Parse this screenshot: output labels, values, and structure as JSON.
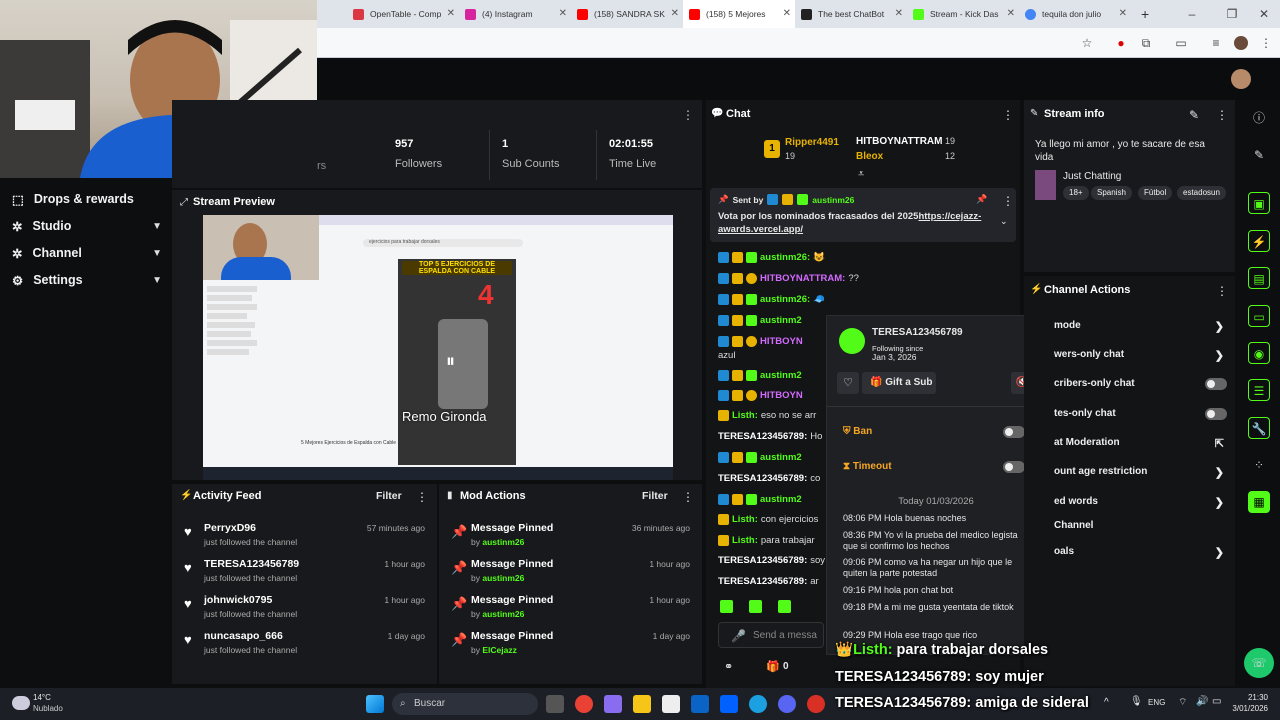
{
  "browser": {
    "tabs": [
      {
        "title": "OpenTable - Comp",
        "color": "#da3743"
      },
      {
        "title": "(4) Instagram",
        "color": "#d6249f"
      },
      {
        "title": "(158) SANDRA SK",
        "color": "#ff0000"
      },
      {
        "title": "(158) 5 Mejores",
        "color": "#ff0000"
      },
      {
        "title": "The best ChatBot",
        "color": "#222222"
      },
      {
        "title": "Stream - Kick Das",
        "color": "#53fc18"
      },
      {
        "title": "tequila don julio",
        "color": "#4285f4"
      }
    ],
    "new_tab": "+"
  },
  "sidebar": {
    "items": [
      {
        "label": "Drops & rewards",
        "icon": "gift-icon"
      },
      {
        "label": "Studio",
        "icon": "gear-icon"
      },
      {
        "label": "Channel",
        "icon": "gear-icon"
      },
      {
        "label": "Settings",
        "icon": "gear-icon"
      }
    ]
  },
  "stats": {
    "partial_label": "rs",
    "followers": {
      "value": "957",
      "label": "Followers"
    },
    "subs": {
      "value": "1",
      "label": "Sub Counts"
    },
    "time": {
      "value": "02:01:55",
      "label": "Time Live"
    }
  },
  "preview": {
    "title": "Stream Preview",
    "video_title": "TOP 5 EJERCICIOS DE ESPALDA CON CABLE",
    "number": "4",
    "exercise": "Remo Gironda",
    "yt_caption": "5 Mejores Ejercicios de Espalda con Cable ...",
    "search": "ejercicios para trabajar dorsales"
  },
  "activity": {
    "title": "Activity Feed",
    "filter": "Filter",
    "rows": [
      {
        "name": "PerryxD96",
        "sub": "just followed the channel",
        "time": "57 minutes ago"
      },
      {
        "name": "TERESA123456789",
        "sub": "just followed the channel",
        "time": "1 hour ago"
      },
      {
        "name": "johnwick0795",
        "sub": "just followed the channel",
        "time": "1 hour ago"
      },
      {
        "name": "nuncasapo_666",
        "sub": "just followed the channel",
        "time": "1 day ago"
      }
    ]
  },
  "modactions": {
    "title": "Mod Actions",
    "filter": "Filter",
    "rows": [
      {
        "action": "Message Pinned",
        "by": "by ",
        "who": "austinm26",
        "time": "36 minutes ago"
      },
      {
        "action": "Message Pinned",
        "by": "by ",
        "who": "austinm26",
        "time": "1 hour ago"
      },
      {
        "action": "Message Pinned",
        "by": "by ",
        "who": "austinm26",
        "time": "1 hour ago"
      },
      {
        "action": "Message Pinned",
        "by": "by ",
        "who": "ElCejazz",
        "time": "1 day ago"
      }
    ]
  },
  "chat": {
    "title": "Chat",
    "top": [
      {
        "name": "Ripper4491",
        "n": "19",
        "color": "#e8b300"
      },
      {
        "name": "HITBOYNATTRAM",
        "n": "19",
        "color": "#ffffff"
      },
      {
        "name": "Bleox",
        "n": "12",
        "color": "#e8b300"
      }
    ],
    "rank": "1",
    "pinned": {
      "sent_by": "Sent by",
      "who": "austinm26",
      "text": "Vota por los nominados fracasados del 2025",
      "link": "https://cejazz-awards.vercel.app/"
    },
    "messages": [
      {
        "name": "austinm26:",
        "text": "😺",
        "color": "#53fc18"
      },
      {
        "name": "HITBOYNATTRAM:",
        "text": "??",
        "color": "#d36aff"
      },
      {
        "name": "austinm26:",
        "text": "🧢",
        "color": "#53fc18"
      },
      {
        "name": "austinm2",
        "text": "",
        "color": "#53fc18"
      },
      {
        "name": "HITBOYN",
        "text": "",
        "color": "#d36aff"
      },
      {
        "name": "",
        "text": "azul",
        "color": "#dddddd"
      },
      {
        "name": "austinm2",
        "text": "",
        "color": "#53fc18"
      },
      {
        "name": "HITBOYN",
        "text": "",
        "color": "#d36aff"
      },
      {
        "name": "Listh:",
        "text": "eso no se arr",
        "color": "#53fc18"
      },
      {
        "name": "TERESA123456789:",
        "text": "Ho",
        "color": "#ffffff"
      },
      {
        "name": "austinm2",
        "text": "",
        "color": "#53fc18"
      },
      {
        "name": "TERESA123456789:",
        "text": "co",
        "color": "#ffffff"
      },
      {
        "name": "austinm2",
        "text": "",
        "color": "#53fc18"
      },
      {
        "name": "Listh:",
        "text": "con ejercicios",
        "color": "#53fc18"
      },
      {
        "name": "Listh:",
        "text": "para trabajar",
        "color": "#53fc18"
      },
      {
        "name": "TERESA123456789:",
        "text": "soy",
        "color": "#ffffff"
      },
      {
        "name": "TERESA123456789:",
        "text": "ar",
        "color": "#ffffff"
      }
    ],
    "input_placeholder": "Send a messa",
    "count": "0"
  },
  "usercard": {
    "name": "TERESA123456789",
    "following_label": "Following since",
    "following_date": "Jan 3, 2026",
    "gift": "Gift a Sub",
    "ban": "Ban",
    "timeout": "Timeout",
    "date_header": "Today 01/03/2026",
    "history": [
      {
        "time": "08:06 PM",
        "text": "Hola buenas noches"
      },
      {
        "time": "08:36 PM",
        "text": "Yo vi la prueba del medico legista que si confirmo los hechos"
      },
      {
        "time": "09:06 PM",
        "text": "como va ha negar un hijo que le quiten la parte potestad"
      },
      {
        "time": "09:16 PM",
        "text": "hola pon chat bot"
      },
      {
        "time": "09:18 PM",
        "text": "a mi me gusta yeentata de tiktok"
      },
      {
        "time": "09:29 PM",
        "text": "Hola ese trago que rico"
      }
    ]
  },
  "streaminfo": {
    "title": "Stream info",
    "stream_title": "Ya llego mi amor , yo te sacare de esa vida",
    "category": "Just Chatting",
    "tags": [
      "18+",
      "Spanish",
      "Fútbol",
      "estadosun"
    ]
  },
  "channel_actions": {
    "title": "Channel Actions",
    "items": [
      {
        "label": "mode",
        "kind": "chev"
      },
      {
        "label": "wers-only chat",
        "kind": "chev"
      },
      {
        "label": "cribers-only chat",
        "kind": "toggle"
      },
      {
        "label": "tes-only chat",
        "kind": "toggle"
      },
      {
        "label": "at Moderation",
        "kind": "ext"
      },
      {
        "label": "ount age restriction",
        "kind": "chev"
      },
      {
        "label": "ed words",
        "kind": "chev"
      },
      {
        "label": "Channel",
        "kind": "none"
      },
      {
        "label": "oals",
        "kind": "chev"
      }
    ]
  },
  "overlay": {
    "lines": [
      {
        "name": "Listh:",
        "text": " para trabajar dorsales"
      },
      {
        "name": "TERESA123456789:",
        "text": " soy mujer"
      },
      {
        "name": "TERESA123456789:",
        "text": " amiga de sideral"
      }
    ]
  },
  "taskbar": {
    "temp": "14°C",
    "weather": "Nublado",
    "search": "Buscar",
    "lang": "ENG",
    "time": "21:30",
    "date": "3/01/2026"
  }
}
